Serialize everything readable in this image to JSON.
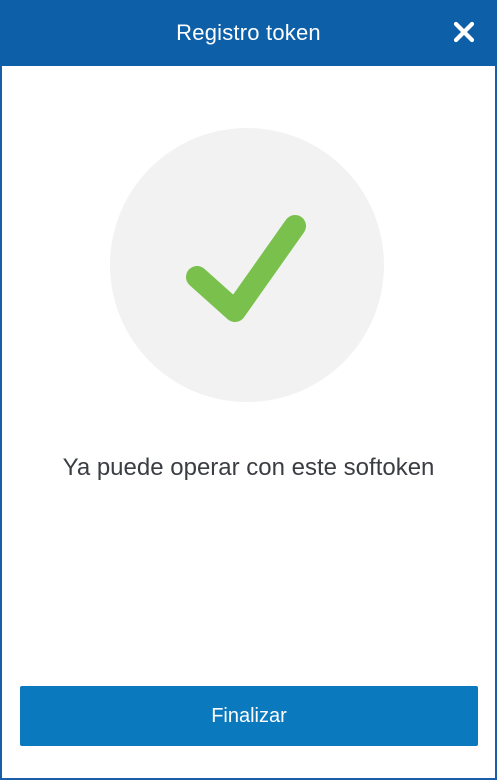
{
  "dialog": {
    "title": "Registro token",
    "close_icon": "close-icon",
    "success_icon": "checkmark-icon",
    "message": "Ya puede operar con este softoken",
    "finish_label": "Finalizar"
  },
  "colors": {
    "header": "#0d5fa8",
    "accent_button": "#0a79be",
    "check": "#7ac04d",
    "circle": "#f2f2f2",
    "text": "#3a3d42"
  }
}
